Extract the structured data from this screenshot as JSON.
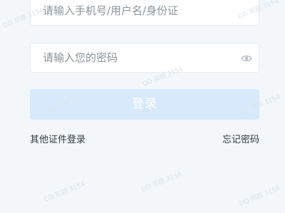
{
  "login_form": {
    "username_placeholder": "请输入手机号/用户名/身份证",
    "password_placeholder": "请输入您的密码",
    "password_visibility_icon": "eye-icon",
    "submit_label": "登录",
    "other_id_login": "其他证件登录",
    "forgot_password": "忘记密码"
  },
  "colors": {
    "page_background": "#f3f7fa",
    "field_background": "#ffffff",
    "submit_button_background": "#d7e9fb",
    "placeholder_text": "#8a949c",
    "link_text": "#333a40"
  },
  "watermark": "DD 邓超 3154"
}
